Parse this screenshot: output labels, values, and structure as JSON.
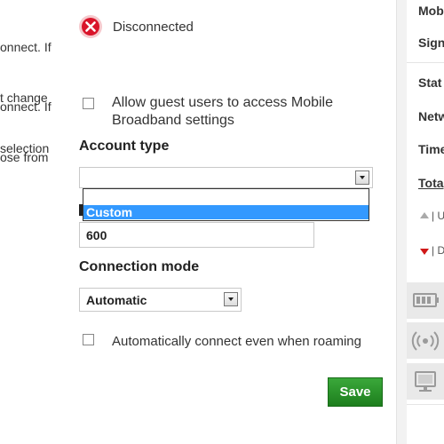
{
  "left_column": {
    "para1": [
      "onnect. If",
      "t change",
      "selection"
    ],
    "para2": [
      "onnect. If",
      "ose from"
    ]
  },
  "status": {
    "icon": "error-icon",
    "text": "Disconnected"
  },
  "guest_access": {
    "checked": false,
    "label_line1": "Allow guest users to access Mobile",
    "label_line2": "Broadband settings"
  },
  "account_type": {
    "title": "Account type",
    "selected_value": "",
    "option_highlighted": "Custom"
  },
  "value_field": {
    "value": "600"
  },
  "connection_mode": {
    "title": "Connection mode",
    "selected_value": "Automatic"
  },
  "roaming": {
    "checked": false,
    "label": "Automatically connect even when roaming"
  },
  "save_label": "Save",
  "right_panel": {
    "labels": [
      "Mob",
      "Sign",
      "Stat",
      "Netw",
      "Time",
      "Tota"
    ],
    "up_label": "| U",
    "down_label": "| D",
    "icons": [
      "battery-icon",
      "signal-icon",
      "monitor-icon"
    ]
  },
  "colors": {
    "error_red": "#d9142a",
    "highlight_blue": "#3399ff",
    "save_green": "#2a952a",
    "up_arrow": "#aaaaaa",
    "down_arrow": "#d01818"
  }
}
